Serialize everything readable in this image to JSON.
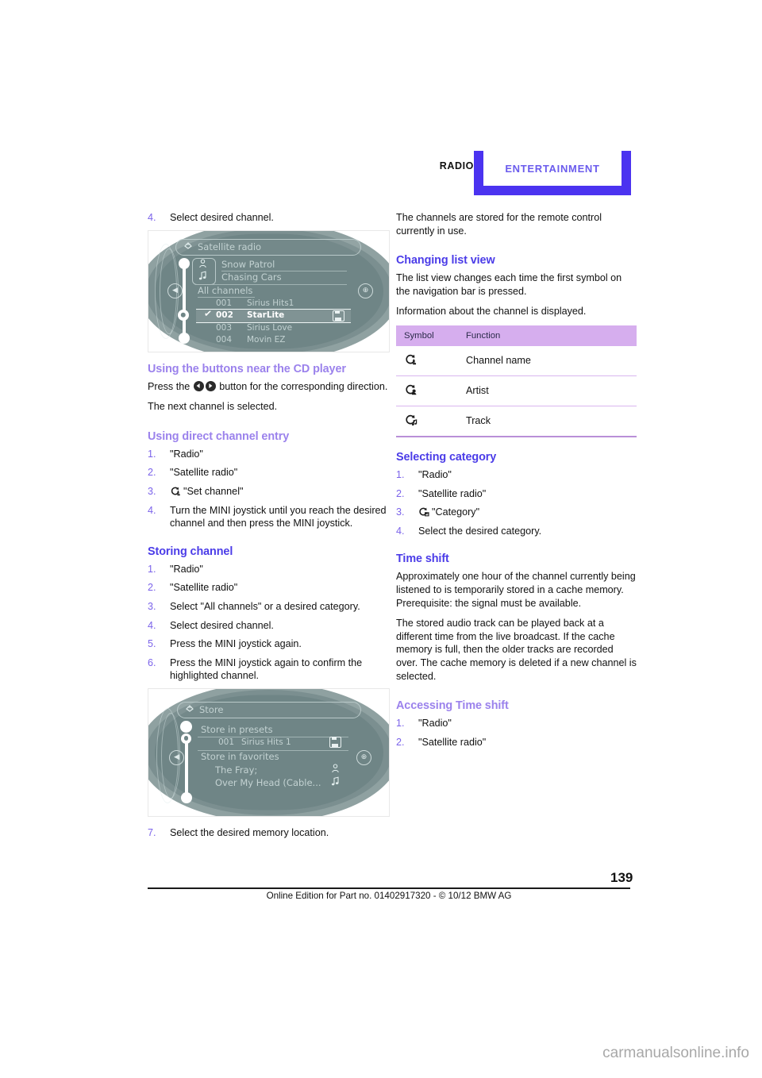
{
  "header": {
    "left_label": "RADIO",
    "right_label": "ENTERTAINMENT",
    "accent_color": "#4b33f0",
    "right_label_color": "#6b5ced"
  },
  "left_column": {
    "step4_num": "4.",
    "step4_text": "Select desired channel.",
    "screenshot1": {
      "title": "Satellite radio",
      "now_playing_artist": "Snow Patrol",
      "now_playing_track": "Chasing Cars",
      "list_header": "All channels",
      "rows": [
        {
          "num": "001",
          "name": "Sirius Hits1",
          "selected": false
        },
        {
          "num": "002",
          "name": "StarLite",
          "selected": true
        },
        {
          "num": "003",
          "name": "Sirius Love",
          "selected": false
        },
        {
          "num": "004",
          "name": "Movin EZ",
          "selected": false
        }
      ]
    },
    "sec_buttons": {
      "heading": "Using the buttons near the CD player",
      "para_pre": "Press the",
      "para_post": "button for the corresponding direction.",
      "para2": "The next channel is selected."
    },
    "sec_direct": {
      "heading": "Using direct channel entry",
      "steps": [
        {
          "num": "1.",
          "text": "\"Radio\"",
          "icon": ""
        },
        {
          "num": "2.",
          "text": "\"Satellite radio\"",
          "icon": ""
        },
        {
          "num": "3.",
          "text": "\"Set channel\"",
          "icon": "cycle-channel-icon"
        },
        {
          "num": "4.",
          "text": "Turn the MINI joystick until you reach the desired channel and then press the MINI joystick.",
          "icon": ""
        }
      ]
    },
    "sec_storing": {
      "heading": "Storing channel",
      "steps": [
        {
          "num": "1.",
          "text": "\"Radio\""
        },
        {
          "num": "2.",
          "text": "\"Satellite radio\""
        },
        {
          "num": "3.",
          "text": "Select \"All channels\" or a desired category."
        },
        {
          "num": "4.",
          "text": "Select desired channel."
        },
        {
          "num": "5.",
          "text": "Press the MINI joystick again."
        },
        {
          "num": "6.",
          "text": "Press the MINI joystick again to confirm the highlighted channel."
        }
      ]
    },
    "screenshot2": {
      "title": "Store",
      "group1": "Store in presets",
      "preset_num": "001",
      "preset_name": "Sirius Hits 1",
      "group2": "Store in favorites",
      "fav_artist": "The Fray;",
      "fav_track": "Over My Head (Cable..."
    },
    "step7_num": "7.",
    "step7_text": "Select the desired memory location."
  },
  "right_column": {
    "intro": "The channels are stored for the remote control currently in use.",
    "sec_listview": {
      "heading": "Changing list view",
      "para1": "The list view changes each time the first symbol on the navigation bar is pressed.",
      "para2": "Information about the channel is displayed."
    },
    "table": {
      "columns": [
        "Symbol",
        "Function"
      ],
      "rows": [
        {
          "icon": "cycle-channel-icon",
          "function": "Channel name"
        },
        {
          "icon": "cycle-artist-icon",
          "function": "Artist"
        },
        {
          "icon": "cycle-track-icon",
          "function": "Track"
        }
      ]
    },
    "sec_category": {
      "heading": "Selecting category",
      "steps": [
        {
          "num": "1.",
          "text": "\"Radio\"",
          "icon": ""
        },
        {
          "num": "2.",
          "text": "\"Satellite radio\"",
          "icon": ""
        },
        {
          "num": "3.",
          "text": "\"Category\"",
          "icon": "cycle-category-icon"
        },
        {
          "num": "4.",
          "text": "Select the desired category.",
          "icon": ""
        }
      ]
    },
    "sec_timeshift": {
      "heading": "Time shift",
      "para1": "Approximately one hour of the channel currently being listened to is temporarily stored in a cache memory. Prerequisite: the signal must be available.",
      "para2": "The stored audio track can be played back at a different time from the live broadcast. If the cache memory is full, then the older tracks are recorded over. The cache memory is deleted if a new channel is selected."
    },
    "sec_accessing": {
      "heading": "Accessing Time shift",
      "steps": [
        {
          "num": "1.",
          "text": "\"Radio\""
        },
        {
          "num": "2.",
          "text": "\"Satellite radio\""
        }
      ]
    }
  },
  "footer": {
    "page_number": "139",
    "note": "Online Edition for Part no. 01402917320 - © 10/12 BMW AG"
  },
  "watermark": "carmanualsonline.info"
}
